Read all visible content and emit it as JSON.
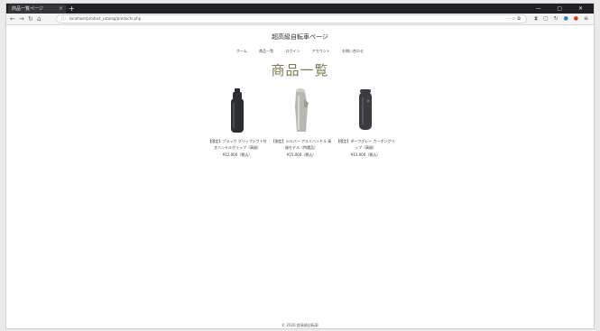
{
  "browser": {
    "tab_title": "商品一覧ページ",
    "tab_close": "×",
    "new_tab": "+",
    "window_controls": "— ▢ ✕",
    "nav_back": "←",
    "nav_forward": "→",
    "nav_reload": "↻",
    "nav_home": "⌂",
    "url": "localhost/product_catalog/products.php",
    "url_right": "⋯ ☆ ⧉",
    "extensions": [
      "⧗",
      "▢",
      "↻",
      "●",
      "●",
      "≡"
    ]
  },
  "site": {
    "title": "超高級自転車ページ",
    "menu": [
      "ホーム",
      "商品一覧",
      "ログイン",
      "アカウント",
      "お問い合わせ"
    ],
    "heading": "商品一覧",
    "footer": "© 2020 超高級自転車"
  },
  "products": [
    {
      "name": "【限定】ブラック グリップシフト付きハンドルグリップ（高級）",
      "price": "¥12,000（税込）",
      "image_color": "#2b2d30"
    },
    {
      "name": "【限定】シルバー アルミハンドル 高級モデル（特選品）",
      "price": "¥15,000（税込）",
      "image_color": "#b9b7b1"
    },
    {
      "name": "【限定】ダークグレー カーボングリップ（高級）",
      "price": "¥13,000（税込）",
      "image_color": "#3a3c40"
    }
  ],
  "colors": {
    "heading": "#7d7a4f",
    "browser_chrome": "#202124"
  }
}
